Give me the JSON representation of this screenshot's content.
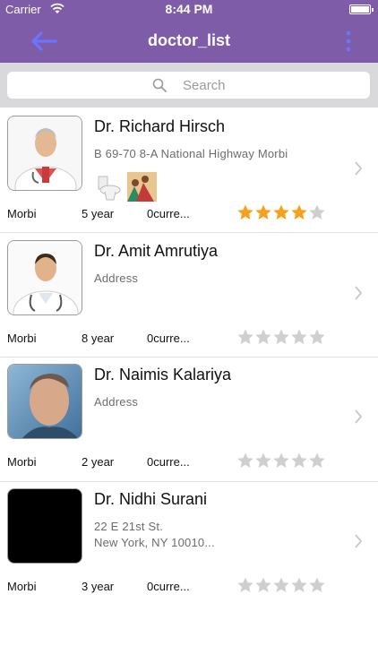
{
  "status_bar": {
    "carrier": "Carrier",
    "time": "8:44 PM"
  },
  "nav": {
    "title": "doctor_list",
    "back_icon": "back-arrow-icon",
    "more_icon": "more-vertical-icon"
  },
  "search": {
    "placeholder": "Search",
    "icon": "search-icon"
  },
  "colors": {
    "primary": "#7e5ca8",
    "accent_back": "#6a74ff",
    "star_filled": "#f4a11d",
    "star_empty": "#cfcfcf"
  },
  "doctors": [
    {
      "name": "Dr. Richard Hirsch",
      "address": "B 69-70 8-A National Highway Morbi",
      "city": "Morbi",
      "experience": "5 year",
      "current": "0curre...",
      "rating": 4,
      "has_thumbnails": true
    },
    {
      "name": "Dr. Amit Amrutiya",
      "address": "Address",
      "city": "Morbi",
      "experience": "8 year",
      "current": "0curre...",
      "rating": 0,
      "has_thumbnails": false
    },
    {
      "name": "Dr. Naimis Kalariya",
      "address": "Address",
      "city": "Morbi",
      "experience": "2 year",
      "current": "0curre...",
      "rating": 0,
      "has_thumbnails": false
    },
    {
      "name": "Dr. Nidhi Surani",
      "address": "22 E 21st St.\nNew York, NY 10010...",
      "city": "Morbi",
      "experience": "3 year",
      "current": "0curre...",
      "rating": 0,
      "has_thumbnails": false
    }
  ],
  "max_rating": 5
}
